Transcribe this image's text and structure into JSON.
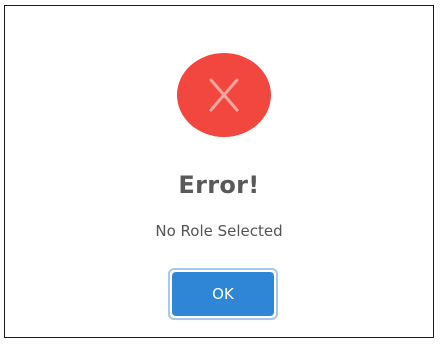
{
  "dialog": {
    "title": "Error!",
    "message": "No Role Selected",
    "ok_label": "OK",
    "icon": "error-x-circle-icon"
  },
  "colors": {
    "error_icon": "#f2473f",
    "error_x": "#f7a7a0",
    "button": "#2f86d6",
    "button_focus_ring": "#a9c7e8",
    "title": "#595959",
    "message": "#545454"
  }
}
